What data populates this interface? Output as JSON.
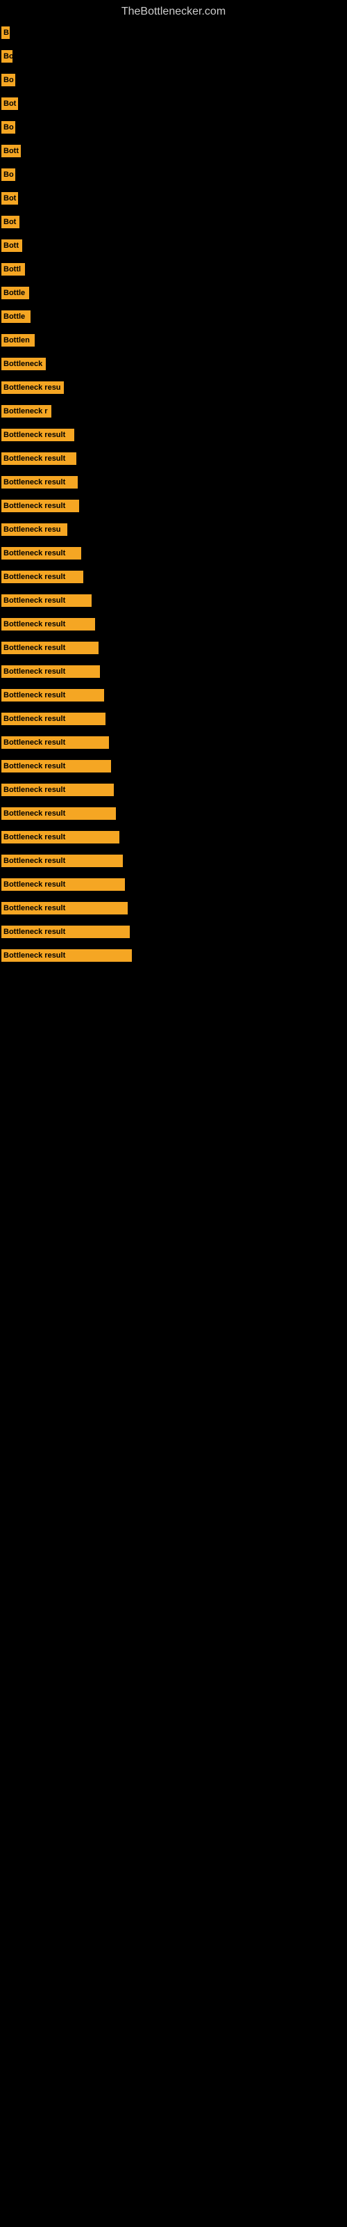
{
  "site_title": "TheBottlenecker.com",
  "bars": [
    {
      "label": "B",
      "width": 12
    },
    {
      "label": "Bo",
      "width": 16
    },
    {
      "label": "Bo",
      "width": 20
    },
    {
      "label": "Bot",
      "width": 24
    },
    {
      "label": "Bo",
      "width": 20
    },
    {
      "label": "Bott",
      "width": 28
    },
    {
      "label": "Bo",
      "width": 20
    },
    {
      "label": "Bot",
      "width": 24
    },
    {
      "label": "Bot",
      "width": 26
    },
    {
      "label": "Bott",
      "width": 30
    },
    {
      "label": "Bottl",
      "width": 34
    },
    {
      "label": "Bottle",
      "width": 40
    },
    {
      "label": "Bottle",
      "width": 42
    },
    {
      "label": "Bottlen",
      "width": 48
    },
    {
      "label": "Bottleneck",
      "width": 64
    },
    {
      "label": "Bottleneck resu",
      "width": 90
    },
    {
      "label": "Bottleneck r",
      "width": 72
    },
    {
      "label": "Bottleneck result",
      "width": 105
    },
    {
      "label": "Bottleneck result",
      "width": 108
    },
    {
      "label": "Bottleneck result",
      "width": 110
    },
    {
      "label": "Bottleneck result",
      "width": 112
    },
    {
      "label": "Bottleneck resu",
      "width": 95
    },
    {
      "label": "Bottleneck result",
      "width": 115
    },
    {
      "label": "Bottleneck result",
      "width": 118
    },
    {
      "label": "Bottleneck result",
      "width": 130
    },
    {
      "label": "Bottleneck result",
      "width": 135
    },
    {
      "label": "Bottleneck result",
      "width": 140
    },
    {
      "label": "Bottleneck result",
      "width": 142
    },
    {
      "label": "Bottleneck result",
      "width": 148
    },
    {
      "label": "Bottleneck result",
      "width": 150
    },
    {
      "label": "Bottleneck result",
      "width": 155
    },
    {
      "label": "Bottleneck result",
      "width": 158
    },
    {
      "label": "Bottleneck result",
      "width": 162
    },
    {
      "label": "Bottleneck result",
      "width": 165
    },
    {
      "label": "Bottleneck result",
      "width": 170
    },
    {
      "label": "Bottleneck result",
      "width": 175
    },
    {
      "label": "Bottleneck result",
      "width": 178
    },
    {
      "label": "Bottleneck result",
      "width": 182
    },
    {
      "label": "Bottleneck result",
      "width": 185
    },
    {
      "label": "Bottleneck result",
      "width": 188
    }
  ]
}
